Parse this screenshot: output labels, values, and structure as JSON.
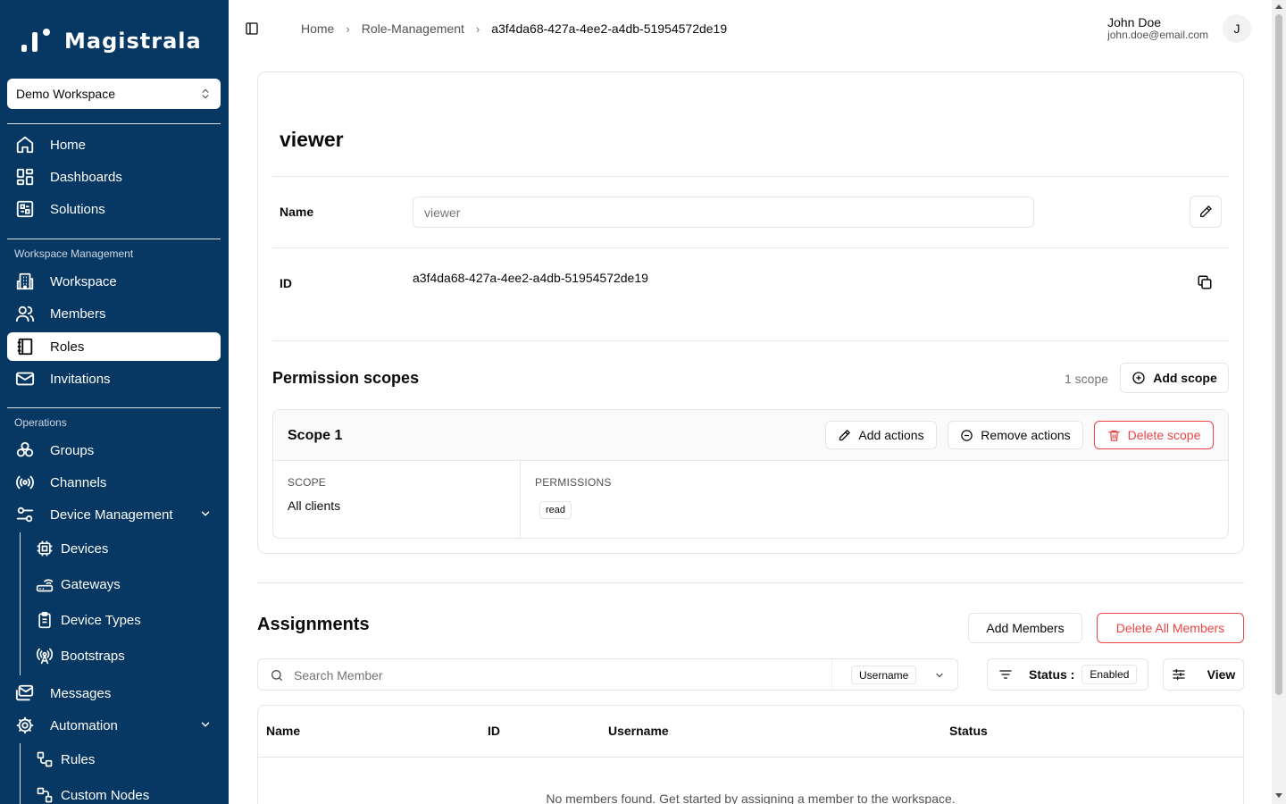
{
  "brand": {
    "name": "Magistrala"
  },
  "workspace_selector": {
    "value": "Demo Workspace"
  },
  "sidebar": {
    "main_items": [
      {
        "label": "Home",
        "icon": "home-icon"
      },
      {
        "label": "Dashboards",
        "icon": "dashboards-icon"
      },
      {
        "label": "Solutions",
        "icon": "solutions-icon"
      }
    ],
    "workspace_section": {
      "label": "Workspace Management",
      "items": [
        {
          "label": "Workspace",
          "icon": "building-icon"
        },
        {
          "label": "Members",
          "icon": "users-icon"
        },
        {
          "label": "Roles",
          "icon": "notebook-icon",
          "active": true
        },
        {
          "label": "Invitations",
          "icon": "mail-icon"
        }
      ]
    },
    "operations_section": {
      "label": "Operations",
      "items": [
        {
          "label": "Groups",
          "icon": "groups-icon"
        },
        {
          "label": "Channels",
          "icon": "radio-icon"
        },
        {
          "label": "Device Management",
          "icon": "settings-sliders-icon",
          "expanded": true
        }
      ],
      "device_sub_items": [
        {
          "label": "Devices",
          "icon": "cpu-icon"
        },
        {
          "label": "Gateways",
          "icon": "router-icon"
        },
        {
          "label": "Device Types",
          "icon": "clipboard-icon"
        },
        {
          "label": "Bootstraps",
          "icon": "antenna-icon"
        }
      ],
      "after_items": [
        {
          "label": "Messages",
          "icon": "mail-stack-icon"
        },
        {
          "label": "Automation",
          "icon": "gear-icon",
          "expanded": true
        }
      ],
      "automation_sub_items": [
        {
          "label": "Rules",
          "icon": "workflow-icon"
        },
        {
          "label": "Custom Nodes",
          "icon": "nodes-icon"
        }
      ]
    }
  },
  "breadcrumb": {
    "items": [
      "Home",
      "Role-Management"
    ],
    "current": "a3f4da68-427a-4ee2-a4db-51954572de19"
  },
  "user": {
    "name": "John Doe",
    "email": "john.doe@email.com",
    "initial": "J"
  },
  "role": {
    "title": "viewer",
    "name_label": "Name",
    "name_value": "viewer",
    "id_label": "ID",
    "id_value": "a3f4da68-427a-4ee2-a4db-51954572de19"
  },
  "permission_scopes": {
    "title": "Permission scopes",
    "count_text": "1 scope",
    "add_scope_label": "Add scope",
    "scopes": [
      {
        "name": "Scope 1",
        "add_actions_label": "Add actions",
        "remove_actions_label": "Remove actions",
        "delete_label": "Delete scope",
        "scope_label": "SCOPE",
        "scope_value": "All clients",
        "permissions_label": "PERMISSIONS",
        "permissions": [
          "read"
        ]
      }
    ]
  },
  "assignments": {
    "title": "Assignments",
    "add_members_label": "Add Members",
    "delete_all_label": "Delete All Members",
    "search_placeholder": "Search Member",
    "search_field": "Username",
    "status_label": "Status :",
    "status_value": "Enabled",
    "view_label": "View",
    "columns": [
      "Name",
      "ID",
      "Username",
      "Status"
    ],
    "empty_message": "No members found. Get started by assigning a member to the workspace."
  },
  "colors": {
    "sidebar_bg": "#073763",
    "danger": "#ef4444",
    "border": "#e5e5e5"
  }
}
